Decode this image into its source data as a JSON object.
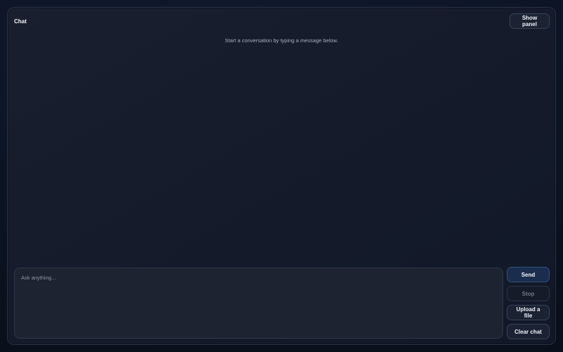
{
  "header": {
    "title": "Chat",
    "show_panel_label": "Show panel"
  },
  "conversation": {
    "empty_hint": "Start a conversation by typing a message below."
  },
  "composer": {
    "placeholder": "Ask anything..."
  },
  "actions": {
    "send_label": "Send",
    "stop_label": "Stop",
    "upload_label": "Upload a file",
    "clear_label": "Clear chat"
  },
  "colors": {
    "background": "#0b1220",
    "panel": "#171d2c",
    "accent": "#1a2d4d"
  }
}
